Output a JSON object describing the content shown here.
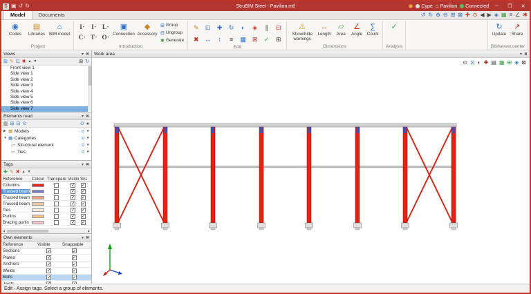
{
  "titlebar": {
    "title": "StruBIM Steel - Pavilion.mtl",
    "user": "Cype",
    "project": "Pavilion",
    "connection": "Connected"
  },
  "tabs": {
    "model": "Model",
    "documents": "Documents"
  },
  "ribbon": {
    "project": {
      "label": "Project",
      "codes": "Codes",
      "libraries": "Libraries",
      "bim_model": "BIM model"
    },
    "introduction": {
      "label": "Introduction",
      "connection": "Connection",
      "accessory": "Accessory",
      "group": "Group",
      "ungroup": "Ungroup",
      "generate": "Generate"
    },
    "edit": {
      "label": "Edit"
    },
    "dimensions": {
      "label": "Dimensions",
      "warnings": "Show/hide warnings",
      "length": "Length",
      "area": "Area",
      "angle": "Angle",
      "count": "Count"
    },
    "analysis": {
      "label": "Analysis"
    },
    "bimserver": {
      "label": "BIMserver.center",
      "update": "Update",
      "share": "Share"
    }
  },
  "views": {
    "title": "Views",
    "items": [
      "Front view 1",
      "Side view 1",
      "Side view 2",
      "Side view 3",
      "Side view 4",
      "Side view 5",
      "Side view 6",
      "Side view 7"
    ],
    "selected": "Side view 7"
  },
  "elements_read": {
    "title": "Elements read",
    "models": "Models",
    "categories": "Categories",
    "children": [
      "Structural element",
      "Ties"
    ]
  },
  "tags": {
    "title": "Tags",
    "headers": [
      "Reference",
      "Colour",
      "Transparent",
      "Visible",
      "Sna"
    ],
    "selected": "Trussed beam 1",
    "rows": [
      {
        "reference": "Columns",
        "color": "#e8251f",
        "transparent": false,
        "visible": true,
        "snappable": true
      },
      {
        "reference": "Trussed beam 1",
        "color": "#8080d0",
        "transparent": false,
        "visible": true,
        "snappable": true
      },
      {
        "reference": "Trussed beam 2",
        "color": "#f0a080",
        "transparent": false,
        "visible": true,
        "snappable": true
      },
      {
        "reference": "Trussed beam 3",
        "color": "#f6c8a0",
        "transparent": false,
        "visible": true,
        "snappable": true
      },
      {
        "reference": "Ties",
        "color": "#f7ead9",
        "transparent": false,
        "visible": true,
        "snappable": true
      },
      {
        "reference": "Purlins",
        "color": "#f3c28e",
        "transparent": false,
        "visible": true,
        "snappable": true
      },
      {
        "reference": "Bracing purlin",
        "color": "#f6c6ce",
        "transparent": false,
        "visible": true,
        "snappable": true
      }
    ]
  },
  "own_elements": {
    "title": "Own elements",
    "headers": [
      "Reference",
      "Visible",
      "Snappable"
    ],
    "selected": "Bolts",
    "rows": [
      {
        "reference": "Sections",
        "visible": true,
        "snappable": true
      },
      {
        "reference": "Plates",
        "visible": true,
        "snappable": true
      },
      {
        "reference": "Anchors",
        "visible": true,
        "snappable": true
      },
      {
        "reference": "Welds",
        "visible": true,
        "snappable": true
      },
      {
        "reference": "Bolts",
        "visible": true,
        "snappable": true
      },
      {
        "reference": "Joints",
        "visible": true,
        "snappable": true
      }
    ]
  },
  "workarea": {
    "title": "Work area"
  },
  "statusbar": {
    "text": "Edit - Assign tags. Select a group of elements."
  },
  "drawing": {
    "column_color": "#e42313",
    "bracing_color": "#d42a1e",
    "beam_color": "#d9d9d9",
    "connection_color": "#3f51b5",
    "columns": 8,
    "braced_bays": 2
  }
}
